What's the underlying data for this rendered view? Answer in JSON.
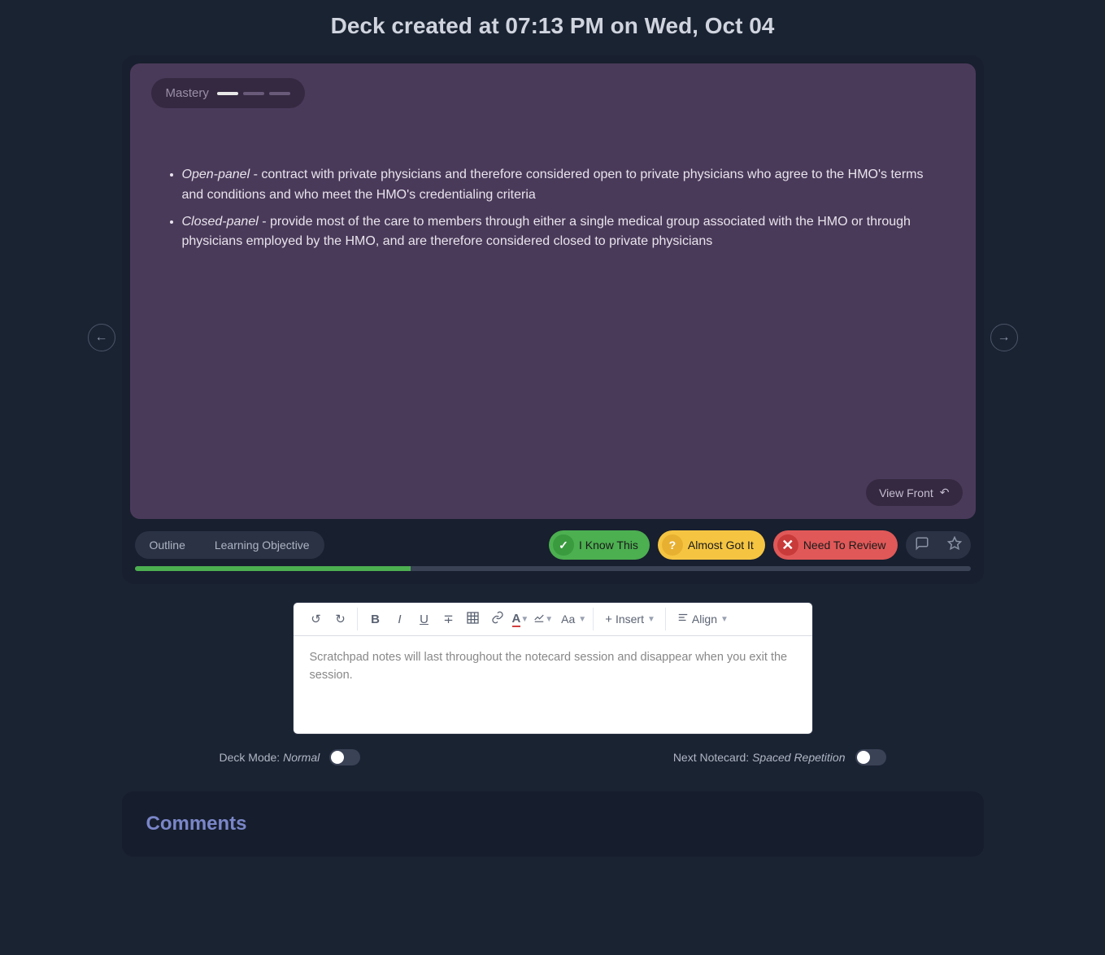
{
  "header": {
    "title": "Deck created at 07:13 PM on Wed, Oct 04"
  },
  "mastery": {
    "label": "Mastery",
    "filled": 1,
    "total": 3
  },
  "card": {
    "bullets": [
      {
        "term": "Open-panel",
        "rest": " - contract with private physicians and therefore considered open to private physicians who agree to the HMO's terms and conditions and who meet the HMO's credentialing criteria"
      },
      {
        "term": "Closed-panel",
        "rest": " - provide most of the care to members through either a single medical group associated with the HMO or through physicians employed by the HMO, and are therefore considered closed to private physicians"
      }
    ],
    "view_front": "View Front"
  },
  "tabs": {
    "outline": "Outline",
    "learning_objective": "Learning Objective"
  },
  "actions": {
    "know": "I Know This",
    "almost": "Almost Got It",
    "review": "Need To Review"
  },
  "progress": {
    "percent": 33
  },
  "editor": {
    "placeholder": "Scratchpad notes will last throughout the notecard session and disappear when you exit the session.",
    "insert_label": "Insert",
    "align_label": "Align",
    "font_size_label": "Aa",
    "text_color_label": "A"
  },
  "toggles": {
    "deck_mode_label": "Deck Mode: ",
    "deck_mode_value": "Normal",
    "next_label": "Next Notecard: ",
    "next_value": "Spaced Repetition"
  },
  "comments": {
    "title": "Comments"
  },
  "colors": {
    "accent_green": "#4caf50",
    "accent_yellow": "#f5c542",
    "accent_red": "#e05858"
  }
}
